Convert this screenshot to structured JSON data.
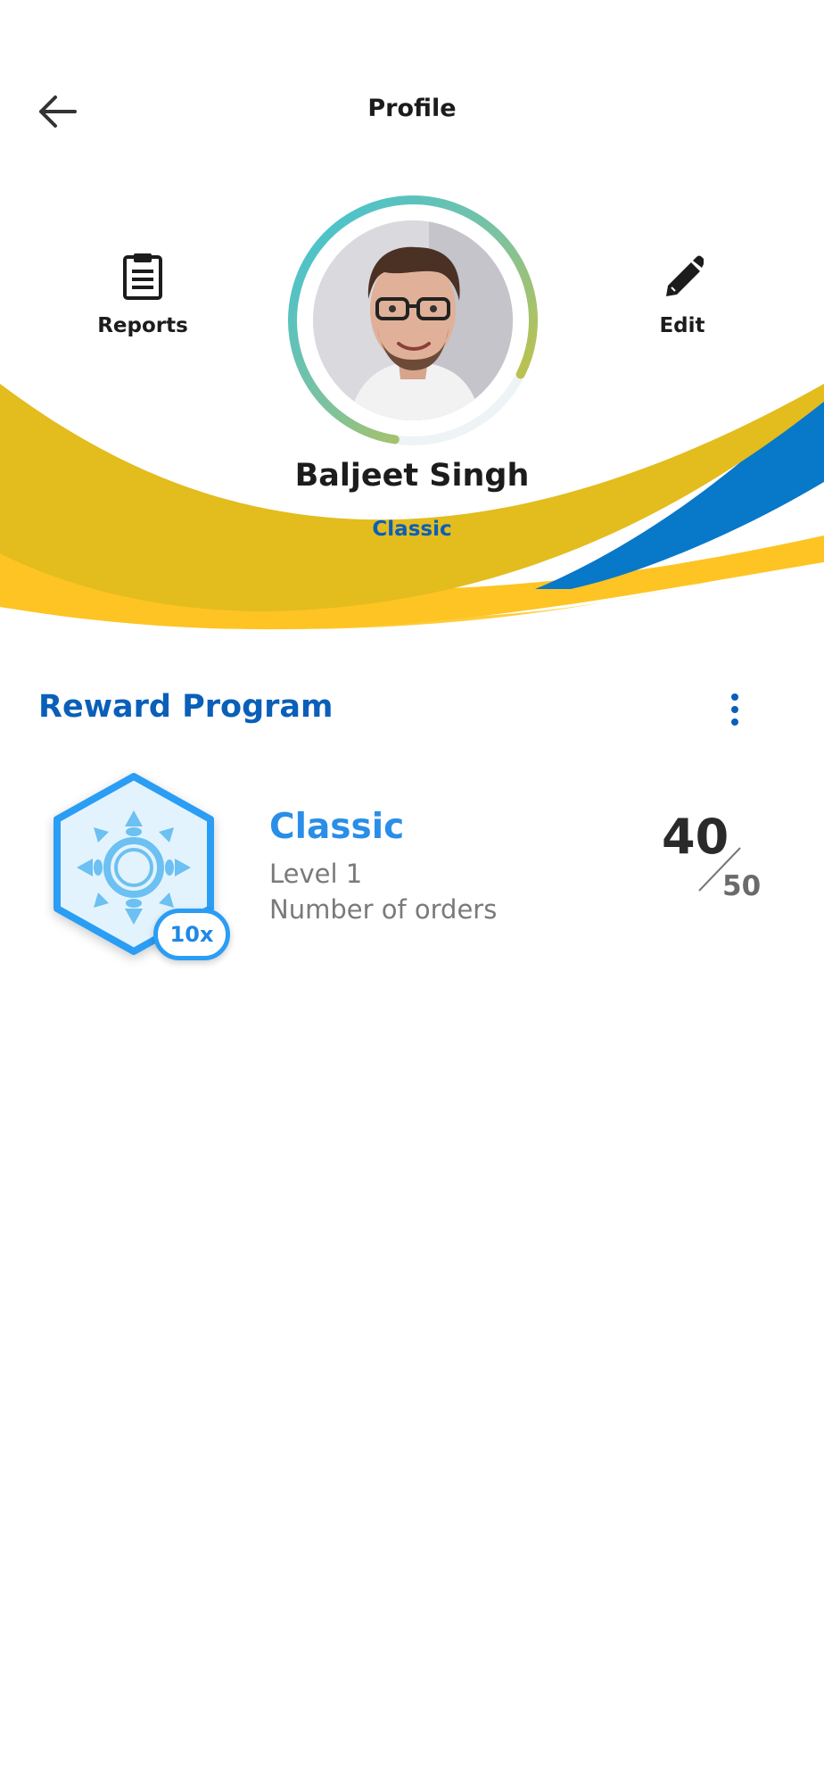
{
  "header": {
    "title": "Profile",
    "back_icon": "arrow-left-icon"
  },
  "actions": {
    "reports": {
      "label": "Reports",
      "icon": "clipboard-icon"
    },
    "edit": {
      "label": "Edit",
      "icon": "pencil-icon"
    }
  },
  "user": {
    "name": "Baljeet Singh",
    "tier": "Classic",
    "avatar": "user-avatar-photo",
    "ring_progress": 0.8
  },
  "reward": {
    "section_title": "Reward Program",
    "more_icon": "more-vertical-icon",
    "badge_icon": "mandala-hexagon-icon",
    "multiplier": "10x",
    "tier_name": "Classic",
    "level": "Level 1",
    "metric": "Number of orders",
    "current": "40",
    "target": "50"
  },
  "colors": {
    "accent_blue": "#0a5fb8",
    "tier_blue": "#2a8ee8",
    "wave_yellow": "#e3bc1e",
    "wave_gold": "#fdc423",
    "wave_blue": "#0878c9"
  }
}
